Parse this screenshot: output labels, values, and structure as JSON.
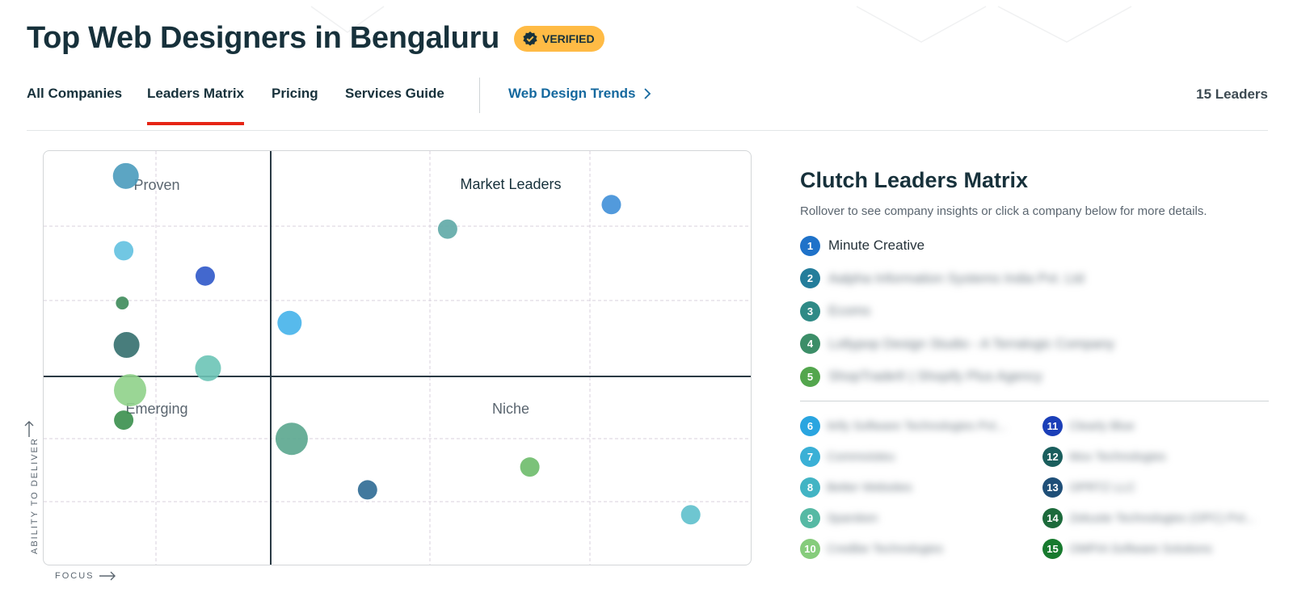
{
  "header": {
    "title": "Top Web Designers in Bengaluru",
    "badge": "VERIFIED"
  },
  "tabs": [
    {
      "label": "All Companies",
      "active": false
    },
    {
      "label": "Leaders Matrix",
      "active": true
    },
    {
      "label": "Pricing",
      "active": false
    },
    {
      "label": "Services Guide",
      "active": false
    }
  ],
  "trends_link": "Web Design Trends",
  "leaders_count": "15 Leaders",
  "colors": {
    "accent_red": "#e62415",
    "badge_yellow": "#ffbb45",
    "link_blue": "#14689e",
    "title_dark": "#17313b"
  },
  "chart_data": {
    "type": "scatter",
    "xlabel": "FOCUS",
    "ylabel": "ABILITY TO DELIVER",
    "quadrants": [
      "Proven",
      "Market Leaders",
      "Emerging",
      "Niche"
    ],
    "grid": true,
    "points": [
      {
        "x": 0.116,
        "y": 0.94,
        "size": 16,
        "color": "#4a9bbd"
      },
      {
        "x": 0.801,
        "y": 0.871,
        "size": 12,
        "color": "#3f8fd8"
      },
      {
        "x": 0.57,
        "y": 0.812,
        "size": 12,
        "color": "#5ea8a6"
      },
      {
        "x": 0.113,
        "y": 0.76,
        "size": 12,
        "color": "#62c1e0"
      },
      {
        "x": 0.228,
        "y": 0.699,
        "size": 12,
        "color": "#2f58c9"
      },
      {
        "x": 0.111,
        "y": 0.634,
        "size": 8,
        "color": "#3d8b5a"
      },
      {
        "x": 0.347,
        "y": 0.586,
        "size": 15,
        "color": "#45b2ea"
      },
      {
        "x": 0.117,
        "y": 0.533,
        "size": 16,
        "color": "#346f6e"
      },
      {
        "x": 0.232,
        "y": 0.477,
        "size": 16,
        "color": "#6cc4b6"
      },
      {
        "x": 0.122,
        "y": 0.424,
        "size": 20,
        "color": "#8fd28a"
      },
      {
        "x": 0.113,
        "y": 0.352,
        "size": 12,
        "color": "#3a8f4c"
      },
      {
        "x": 0.35,
        "y": 0.307,
        "size": 20,
        "color": "#5aa68e"
      },
      {
        "x": 0.686,
        "y": 0.239,
        "size": 12,
        "color": "#6dbb6a"
      },
      {
        "x": 0.457,
        "y": 0.184,
        "size": 12,
        "color": "#2e6a93"
      },
      {
        "x": 0.913,
        "y": 0.124,
        "size": 12,
        "color": "#5ec0cc"
      }
    ]
  },
  "panel": {
    "title": "Clutch Leaders Matrix",
    "subtitle": "Rollover to see company insights or click a company below for more details.",
    "top": [
      {
        "rank": "1",
        "name": "Minute Creative",
        "color": "#1f72c9",
        "blurred": false
      },
      {
        "rank": "2",
        "name": "Aalpha Information Systems India Pvt. Ltd",
        "color": "#247d9b",
        "blurred": true
      },
      {
        "rank": "3",
        "name": "Ecoms",
        "color": "#2f8a86",
        "blurred": true
      },
      {
        "rank": "4",
        "name": "Lollypop Design Studio - A Terralogic Company",
        "color": "#3c8e68",
        "blurred": true
      },
      {
        "rank": "5",
        "name": "ShopTrade® | Shopify Plus Agency",
        "color": "#53a64d",
        "blurred": true
      }
    ],
    "rest": [
      {
        "rank": "6",
        "name": "Itrify Software Technologies Pvt...",
        "color": "#2aa5e0",
        "blurred": true
      },
      {
        "rank": "7",
        "name": "Commoisteu",
        "color": "#3ab0d6",
        "blurred": true
      },
      {
        "rank": "8",
        "name": "Better Websites",
        "color": "#42b4c4",
        "blurred": true
      },
      {
        "rank": "9",
        "name": "Sparsken",
        "color": "#56b9a4",
        "blurred": true
      },
      {
        "rank": "10",
        "name": "Credibe Technologies",
        "color": "#86cc7c",
        "blurred": true
      },
      {
        "rank": "11",
        "name": "Clearly Blue",
        "color": "#1b3fb8",
        "blurred": true
      },
      {
        "rank": "12",
        "name": "Mox Technologies",
        "color": "#1a5e5d",
        "blurred": true
      },
      {
        "rank": "13",
        "name": "OPRTZ LLC",
        "color": "#1f4f78",
        "blurred": true
      },
      {
        "rank": "14",
        "name": "Zekuste Technologies (OPC) Pvt...",
        "color": "#1c6a3b",
        "blurred": true
      },
      {
        "rank": "15",
        "name": "OMPIA Software Solutions",
        "color": "#177a2e",
        "blurred": true
      }
    ]
  }
}
